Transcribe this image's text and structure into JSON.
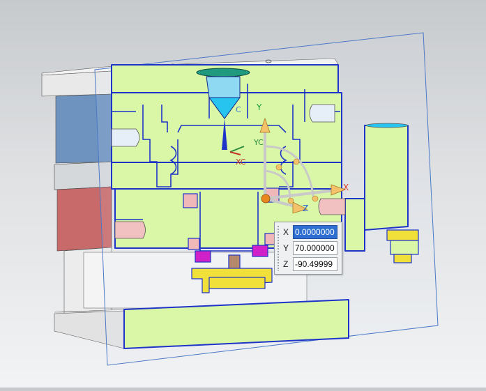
{
  "viewport": {
    "axes": {
      "y_label": "Y",
      "x_label": "X",
      "z_label": "Z"
    },
    "wcs": {
      "xc_label": "XC",
      "yc_label": "YC",
      "zc_label": "C"
    }
  },
  "coord_dialog": {
    "x": {
      "label": "X",
      "value": "0.0000000"
    },
    "y": {
      "label": "Y",
      "value": "70.000000"
    },
    "z": {
      "label": "Z",
      "value": "-90.49999"
    }
  },
  "colors": {
    "section_fill": "#d9f7a6",
    "edge_blue": "#1e34c9",
    "plate_steel_blue": "#6f93bf",
    "plate_red": "#c96a6a",
    "accent_magenta": "#d020c8",
    "accent_yellow": "#f2e03a",
    "accent_cyan": "#28c4f0",
    "accent_teal": "#1f9a7e"
  }
}
